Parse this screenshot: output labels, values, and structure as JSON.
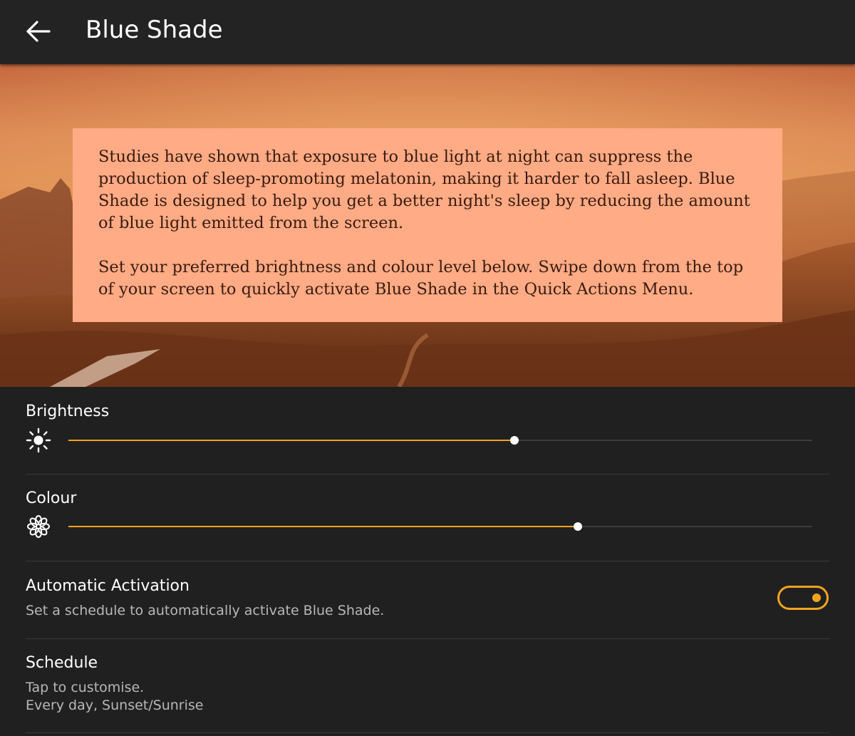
{
  "app_bar": {
    "back_icon": "arrow-left-icon",
    "title": "Blue Shade"
  },
  "hero": {
    "description": "Studies have shown that exposure to blue light at night can suppress the production of sleep-promoting melatonin, making it harder to fall asleep. Blue Shade is designed to help you get a better night's sleep by reducing the amount of blue light emitted from the screen.",
    "instructions": "Set your preferred brightness and colour level below. Swipe down from the top of your screen to quickly activate Blue Shade in the Quick Actions Menu."
  },
  "brightness": {
    "label": "Brightness",
    "icon": "sun-icon",
    "value_fraction": 0.6
  },
  "colour": {
    "label": "Colour",
    "icon": "flower-icon",
    "value_fraction": 0.685
  },
  "automatic_activation": {
    "title": "Automatic Activation",
    "subtitle": "Set a schedule to automatically activate Blue Shade.",
    "enabled": true
  },
  "schedule": {
    "title": "Schedule",
    "subtitle_line1": "Tap to customise.",
    "subtitle_line2": "Every day, Sunset/Sunrise"
  },
  "colors": {
    "accent": "#f2a41f",
    "background": "#202020",
    "info_box": "#ffab85"
  }
}
